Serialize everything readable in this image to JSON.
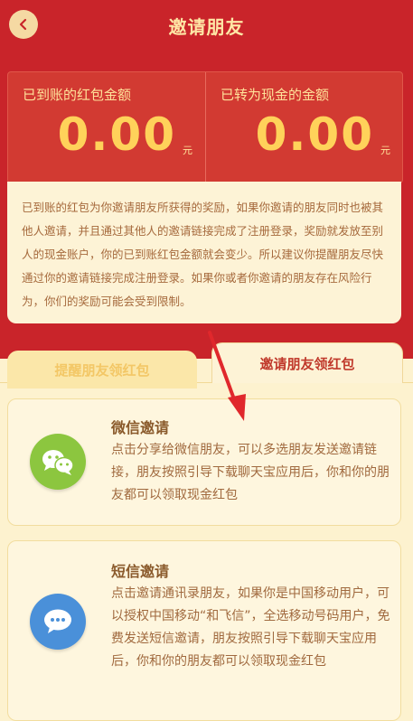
{
  "header": {
    "title": "邀请朋友"
  },
  "stats": {
    "received": {
      "label": "已到账的红包金额",
      "value": "0.00",
      "unit": "元"
    },
    "converted": {
      "label": "已转为现金的金额",
      "value": "0.00",
      "unit": "元"
    }
  },
  "info": {
    "text": "已到账的红包为你邀请朋友所获得的奖励，如果你邀请的朋友同时也被其他人邀请，并且通过其他人的邀请链接完成了注册登录，奖励就发放至别人的现金账户，你的已到账红包金额就会变少。所以建议你提醒朋友尽快通过你的邀请链接完成注册登录。如果你或者你邀请的朋友存在风险行为，你们的奖励可能会受到限制。"
  },
  "tabs": [
    {
      "label": "提醒朋友领红包"
    },
    {
      "label": "邀请朋友领红包"
    }
  ],
  "methods": {
    "wechat": {
      "title": "微信邀请",
      "desc": "点击分享给微信朋友，可以多选朋友发送邀请链接，朋友按照引导下载聊天宝应用后，你和你的朋友都可以领取现金红包",
      "icon": "wechat-icon"
    },
    "sms": {
      "title": "短信邀请",
      "desc": "点击邀请通讯录朋友，如果你是中国移动用户，可以授权中国移动“和飞信”，全选移动号码用户，免费发送短信邀请，朋友按照引导下载聊天宝应用后，你和你的朋友都可以领取现金红包",
      "icon": "message-icon"
    }
  },
  "colors": {
    "brand_red": "#c9242a",
    "gold": "#ffd25a",
    "cream": "#fdf2cf"
  }
}
